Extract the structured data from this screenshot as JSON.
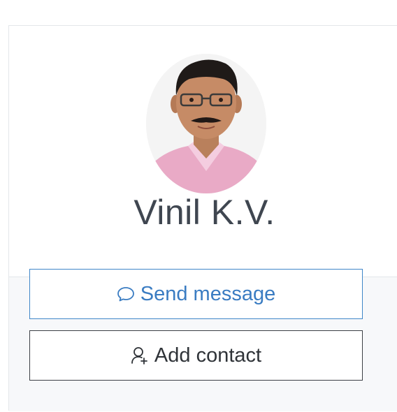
{
  "profile": {
    "name": "Vinil K.V."
  },
  "actions": {
    "send_message_label": "Send message",
    "add_contact_label": "Add contact"
  },
  "icons": {
    "send_message": "chat-bubble-icon",
    "add_contact": "add-user-icon"
  },
  "colors": {
    "primary": "#3a7cc2",
    "text_dark": "#3f4650",
    "border_dark": "#3b3f45"
  }
}
